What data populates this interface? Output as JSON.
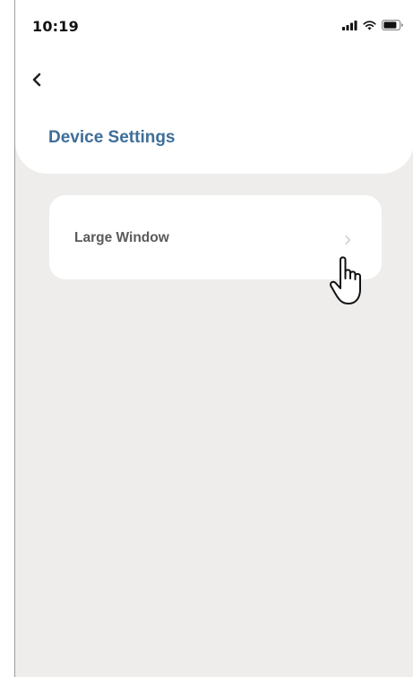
{
  "status_bar": {
    "time": "10:19",
    "icons": [
      "cellular-signal-icon",
      "wifi-icon",
      "battery-icon"
    ]
  },
  "header": {
    "back_icon": "chevron-left-icon",
    "title": "Device Settings"
  },
  "settings": {
    "items": [
      {
        "label": "Large Window",
        "icon": "chevron-right-icon"
      }
    ]
  },
  "cursor": {
    "icon": "hand-pointer-icon"
  },
  "colors": {
    "title": "#3e6e99",
    "background": "#efedeb",
    "card": "#ffffff",
    "label": "#5a5a5a"
  }
}
